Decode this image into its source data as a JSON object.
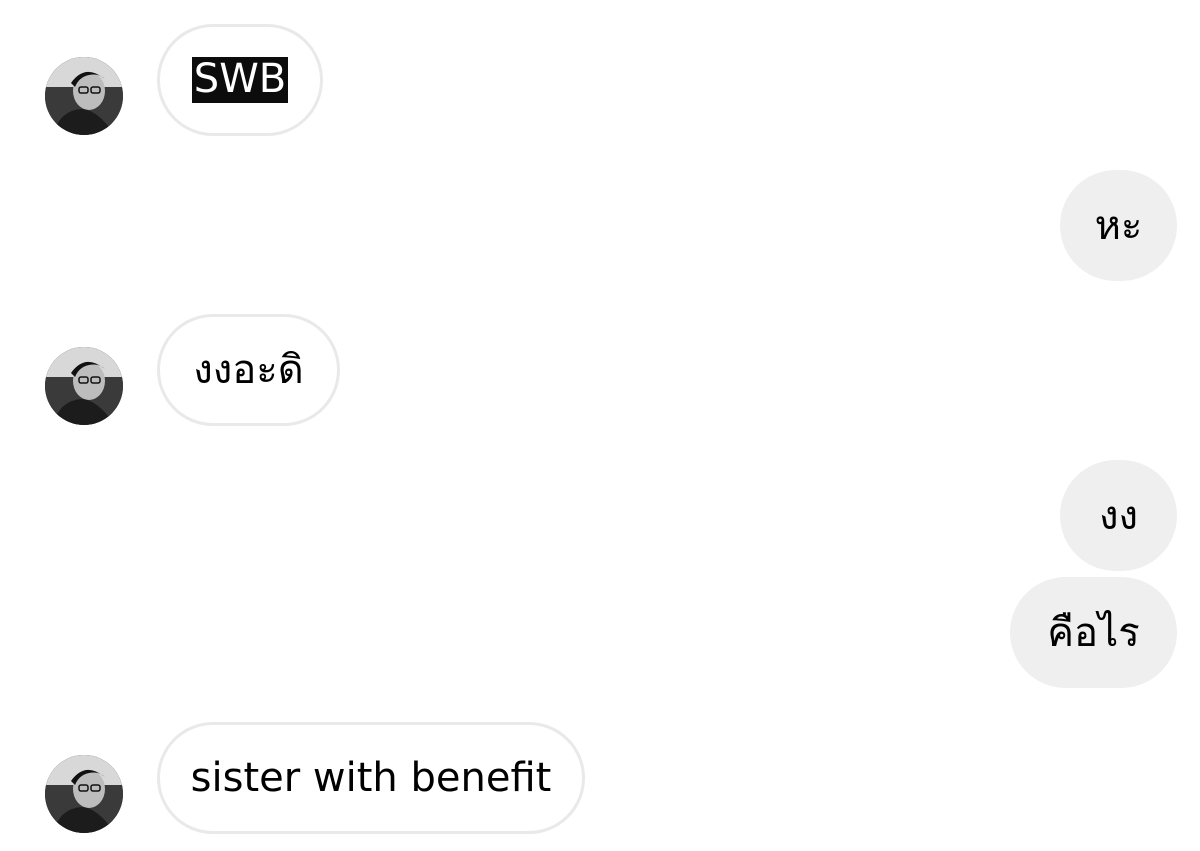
{
  "messages": [
    {
      "side": "incoming",
      "text": "SWB",
      "highlighted": true,
      "avatar": "sender-avatar"
    },
    {
      "side": "outgoing",
      "text": "หะ"
    },
    {
      "side": "incoming",
      "text": "งงอะดิ",
      "avatar": "sender-avatar"
    },
    {
      "side": "outgoing",
      "text": "งง"
    },
    {
      "side": "outgoing",
      "text": "คือไร"
    },
    {
      "side": "incoming",
      "text": "sister with benefit",
      "avatar": "sender-avatar"
    }
  ],
  "colors": {
    "incoming_bubble_border": "#e9e9eb",
    "outgoing_bubble_bg": "#efefef",
    "highlight_bg": "#0c0c0c"
  }
}
